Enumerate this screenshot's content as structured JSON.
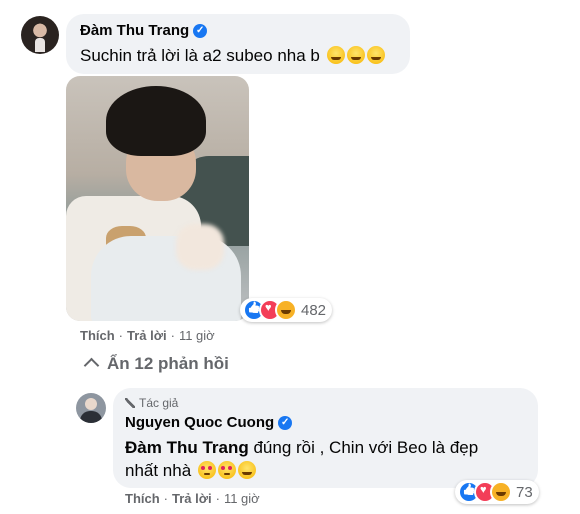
{
  "comment": {
    "author": "Đàm Thu Trang",
    "verified_mark": "✓",
    "text": "Suchin trả lời là a2 subeo nha b",
    "emojis": [
      "laughing-squint",
      "laughing-squint",
      "laughing-squint"
    ],
    "photo": "child-holding-baby-photo",
    "reaction_count": "482",
    "reactions": [
      "like",
      "love",
      "haha"
    ],
    "actions": {
      "like": "Thích",
      "reply": "Trả lời",
      "separator": "·",
      "time": "11 giờ"
    }
  },
  "toggle": {
    "label": "Ẩn 12 phản hồi"
  },
  "reply": {
    "author_tag": "Tác giả",
    "author": "Nguyen Quoc Cuong",
    "verified_mark": "✓",
    "mention": "Đàm Thu Trang",
    "text_line1": " đúng rồi , Chin với Beo là đẹp",
    "text_line2": "nhất nhà",
    "emojis": [
      "heart-eyes",
      "hugging",
      "kissing-heart"
    ],
    "reaction_count": "73",
    "reactions": [
      "like",
      "love",
      "care"
    ],
    "actions": {
      "like": "Thích",
      "reply": "Trả lời",
      "separator": "·",
      "time": "11 giờ"
    }
  },
  "colors": {
    "bubble": "#f0f2f5",
    "verified": "#1877f2",
    "muted": "#65676b"
  }
}
